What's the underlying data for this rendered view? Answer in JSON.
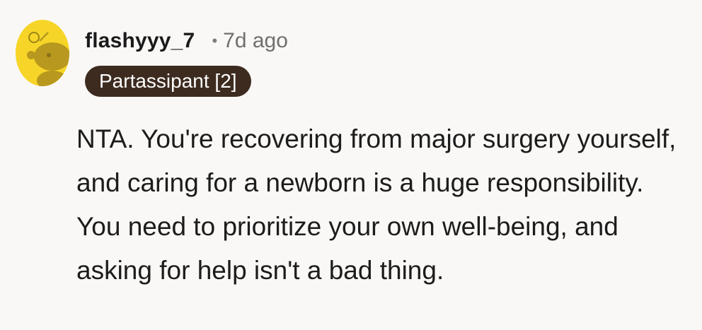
{
  "comment": {
    "username": "flashyyy_7",
    "separator": "•",
    "timestamp": "7d ago",
    "flair": "Partassipant [2]",
    "avatar_icon": "snoo-avatar-icon",
    "body": "NTA. You're recovering from major surgery yourself, and caring for a newborn is a huge responsibility. You need to prioritize your own well-being, and asking for help isn't a bad thing."
  },
  "colors": {
    "background": "#faf8f6",
    "avatar_bg": "#f6d528",
    "flair_bg": "#3d2b1f",
    "flair_text": "#ffffff"
  }
}
